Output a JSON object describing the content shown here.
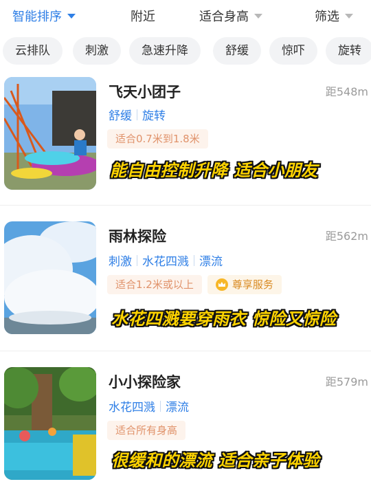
{
  "sortbar": {
    "items": [
      {
        "label": "智能排序",
        "active": true
      },
      {
        "label": "附近",
        "active": false
      },
      {
        "label": "适合身高",
        "active": false
      },
      {
        "label": "筛选",
        "active": false
      }
    ]
  },
  "chips": [
    "云排队",
    "刺激",
    "急速升降",
    "舒缓",
    "惊吓",
    "旋转"
  ],
  "cards": [
    {
      "title": "飞天小团子",
      "distance": "距548m",
      "tags": [
        "舒缓",
        "旋转"
      ],
      "badges": [
        "适合0.7米到1.8米"
      ],
      "caption": "能自由控制升降 适合小朋友"
    },
    {
      "title": "雨林探险",
      "distance": "距562m",
      "tags": [
        "刺激",
        "水花四溅",
        "漂流"
      ],
      "badges": [
        "适合1.2米或以上"
      ],
      "premium_badge": "尊享服务",
      "caption": "水花四溅要穿雨衣 惊险又惊险"
    },
    {
      "title": "小小探险家",
      "distance": "距579m",
      "tags": [
        "水花四溅",
        "漂流"
      ],
      "badges": [
        "适合所有身高"
      ],
      "caption": "很缓和的漂流 适合亲子体验"
    }
  ],
  "colors": {
    "accent": "#2f7fe6",
    "caption": "#ffd400",
    "badge_text": "#e0926a"
  }
}
